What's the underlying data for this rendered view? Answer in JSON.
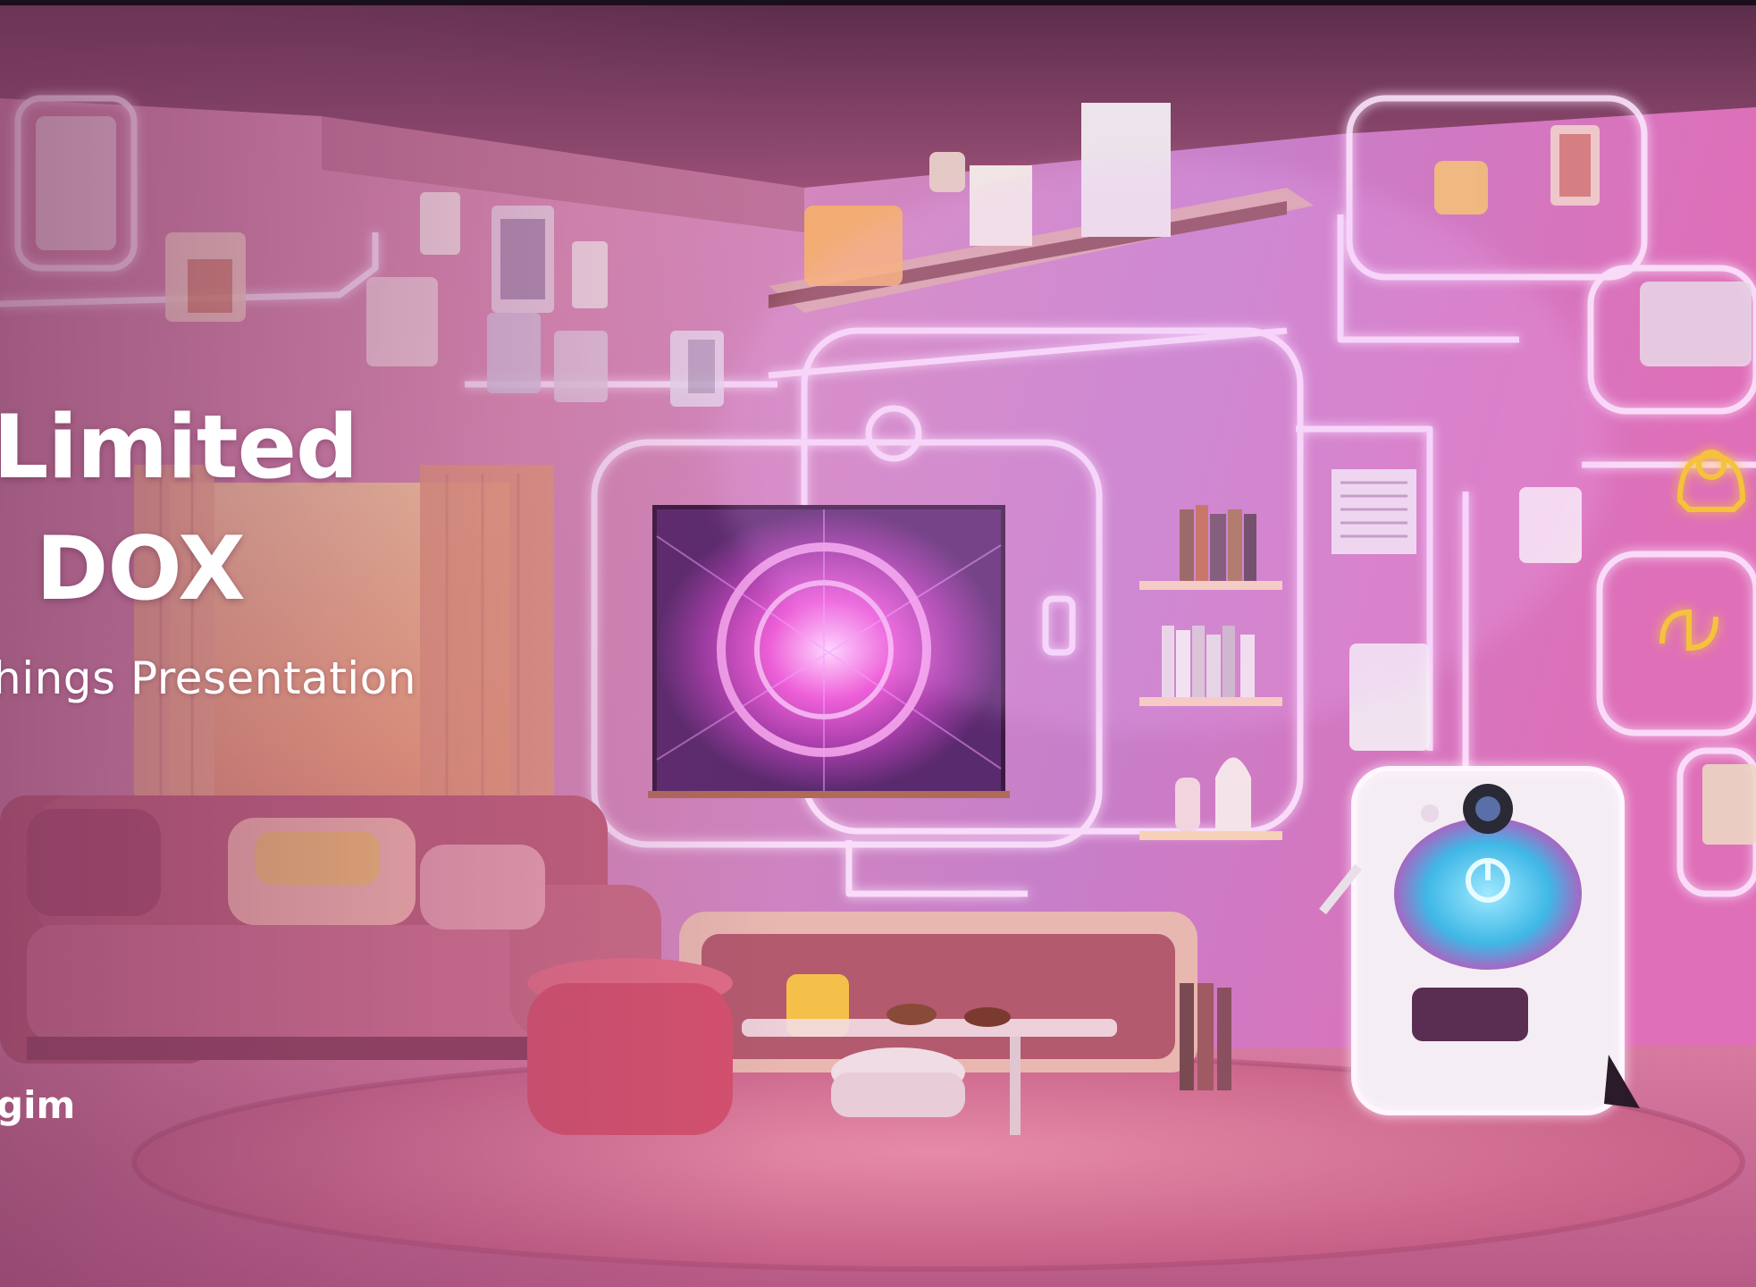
{
  "slide": {
    "title_line1": "Limited",
    "title_line2": "DOX",
    "subtitle": "hings Presentation",
    "author": "gim"
  },
  "scene": {
    "description_icon": "smart-home-living-room-illustration",
    "accent_colors": {
      "pink": "#e35fb3",
      "magenta": "#c93fa8",
      "warm_orange": "#f2a37a",
      "neon_white": "#fde6ff",
      "robot_screen_blue": "#3fb8e6",
      "icon_yellow": "#f5c23d"
    }
  }
}
